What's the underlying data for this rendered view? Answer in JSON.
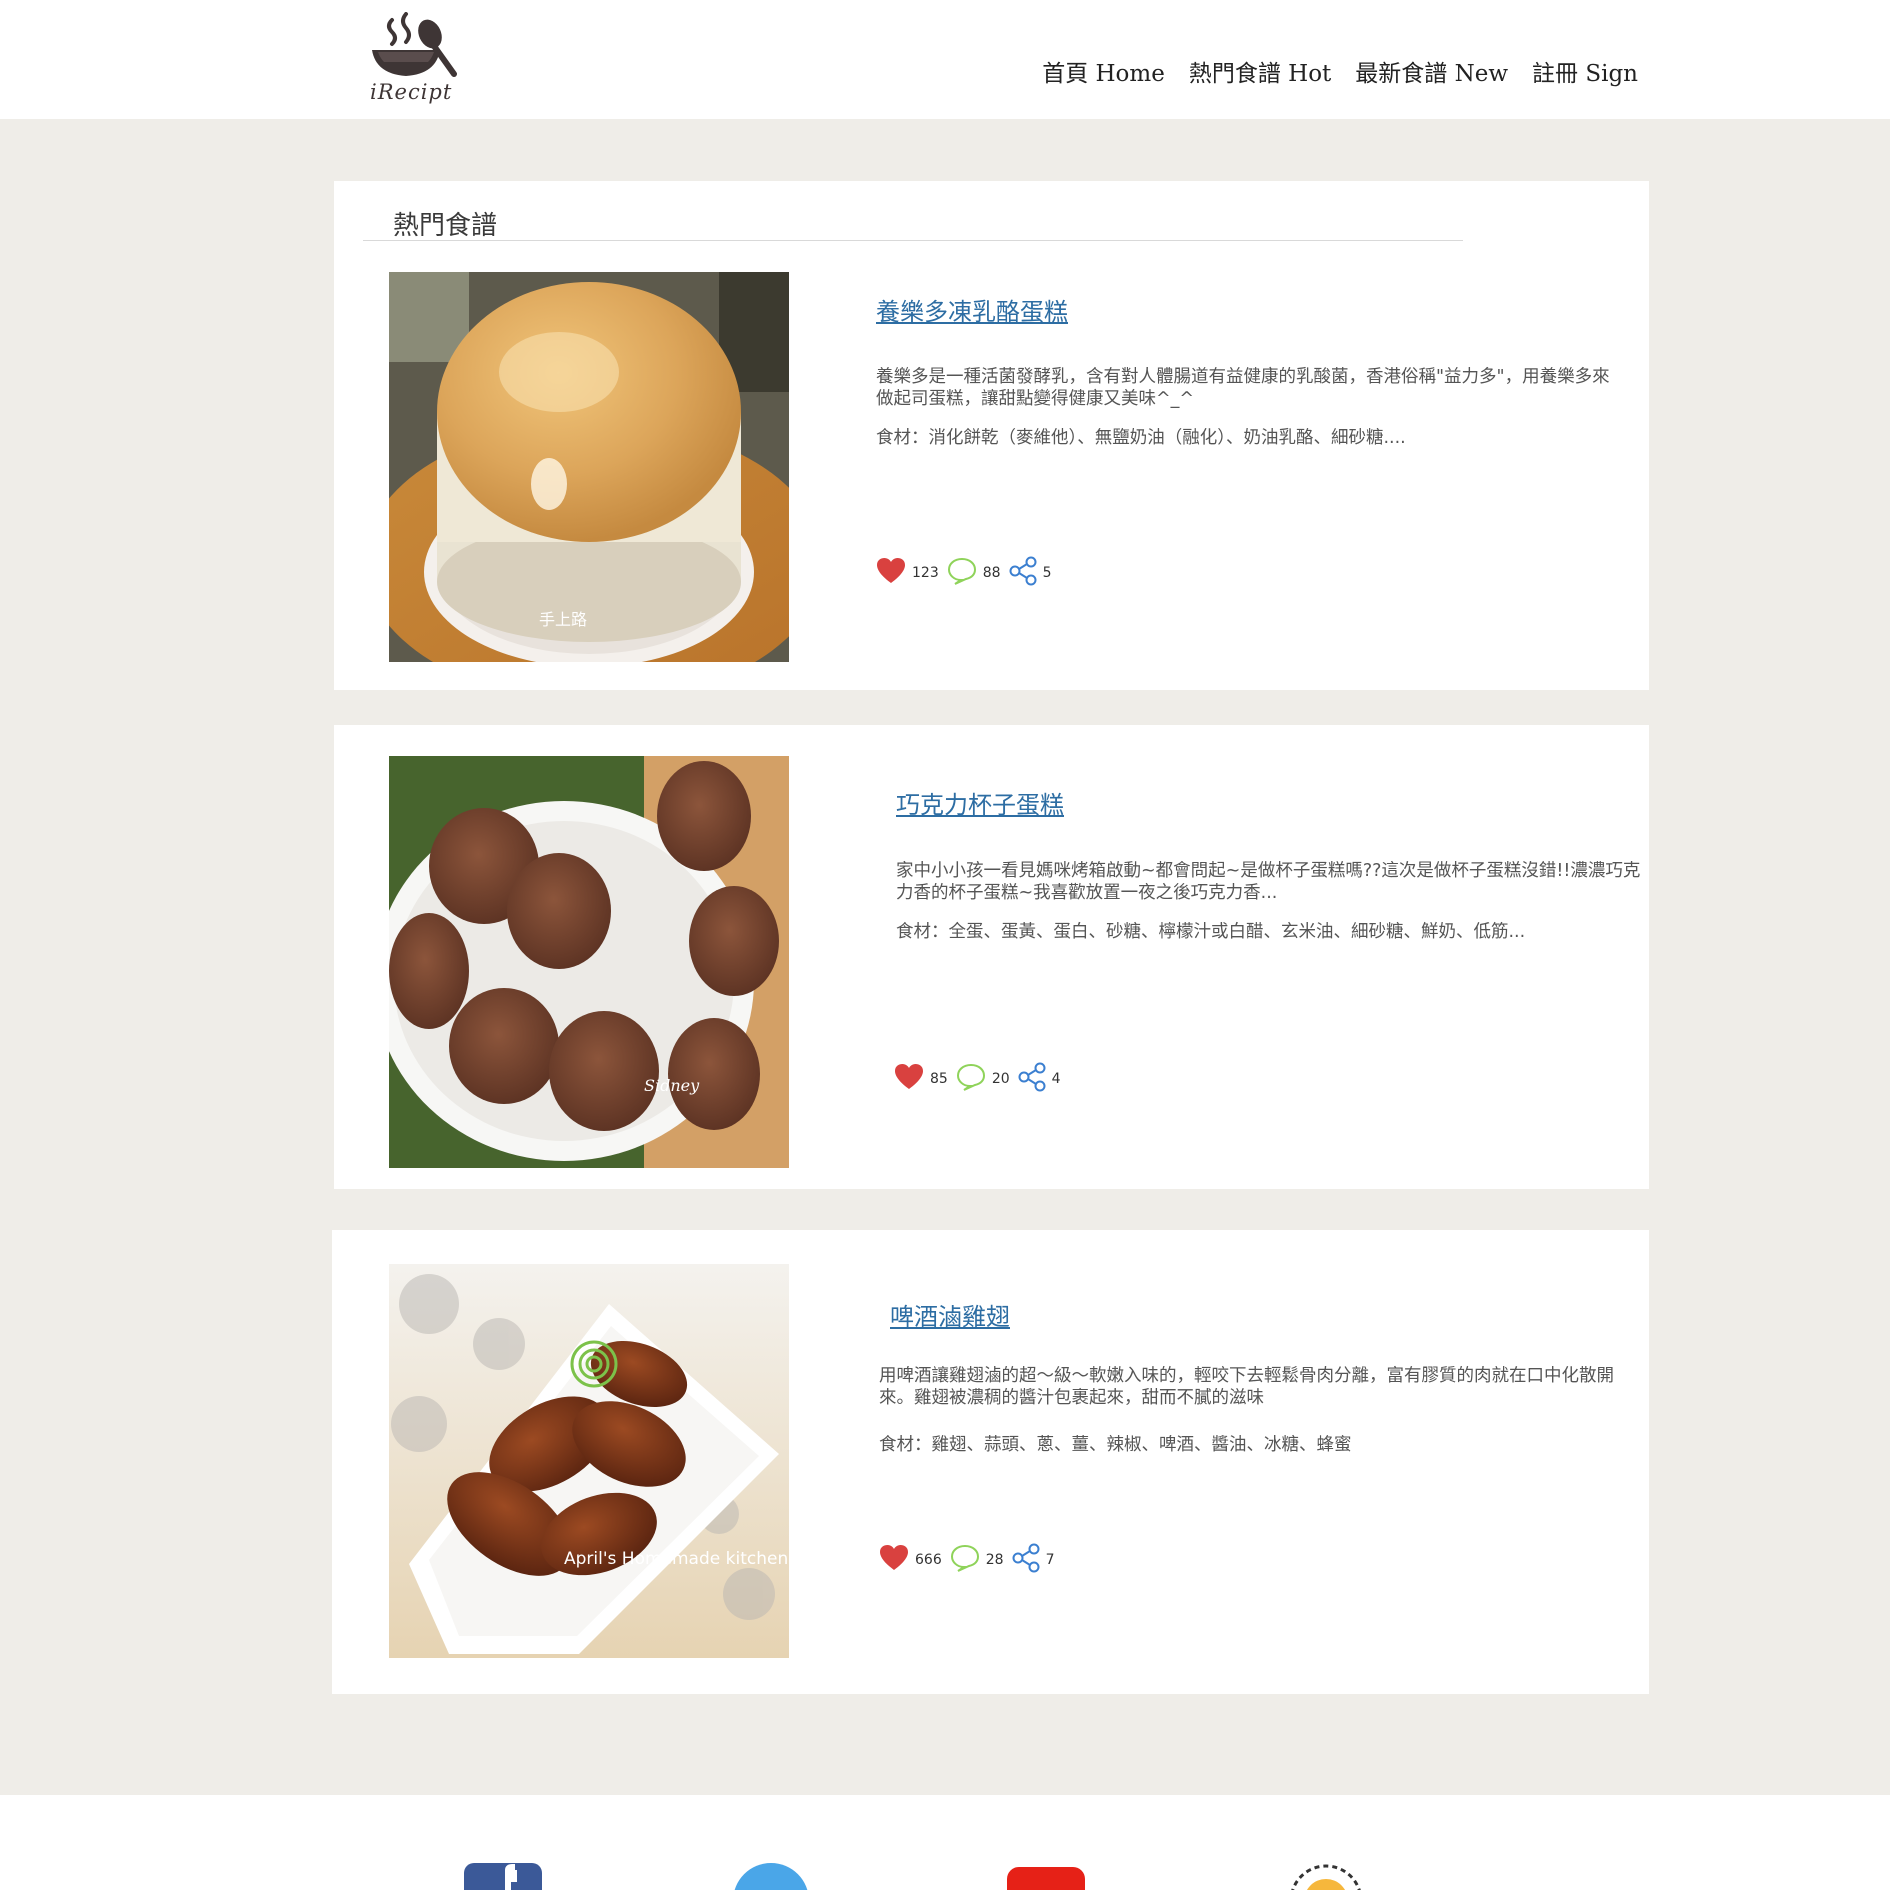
{
  "header": {
    "logo_text": "iRecipt",
    "nav": [
      {
        "label": "首頁 Home"
      },
      {
        "label": "熱門食譜 Hot"
      },
      {
        "label": "最新食譜 New"
      },
      {
        "label": "註冊 Sign"
      }
    ]
  },
  "section": {
    "title": "熱門食譜"
  },
  "recipes": [
    {
      "title": "養樂多凍乳酪蛋糕",
      "desc": "養樂多是一種活菌發酵乳，含有對人體腸道有益健康的乳酸菌，香港俗稱\"益力多\"，用養樂多來做起司蛋糕，讓甜點變得健康又美味^_^",
      "ingredients": "食材：消化餅乾（麥維他）、無鹽奶油（融化）、奶油乳酪、細砂糖....",
      "likes": "123",
      "comments": "88",
      "shares": "5",
      "watermark": "手上路"
    },
    {
      "title": "巧克力杯子蛋糕",
      "desc": "家中小小孩一看見媽咪烤箱啟動~都會問起~是做杯子蛋糕嗎??這次是做杯子蛋糕沒錯!!濃濃巧克力香的杯子蛋糕~我喜歡放置一夜之後巧克力香...",
      "ingredients": "食材：全蛋、蛋黃、蛋白、砂糖、檸檬汁或白醋、玄米油、細砂糖、鮮奶、低筋...",
      "likes": "85",
      "comments": "20",
      "shares": "4",
      "watermark": "Sidney"
    },
    {
      "title": "啤酒滷雞翅",
      "desc": "用啤酒讓雞翅滷的超～級～軟嫩入味的，輕咬下去輕鬆骨肉分離，富有膠質的肉就在口中化散開來。雞翅被濃稠的醬汁包裹起來，甜而不膩的滋味",
      "ingredients": "食材：雞翅、蒜頭、蔥、薑、辣椒、啤酒、醬油、冰糖、蜂蜜",
      "likes": "666",
      "comments": "28",
      "shares": "7",
      "watermark": "April's Homemade kitchen"
    }
  ],
  "colors": {
    "background": "#efede8",
    "card": "#ffffff",
    "link": "#2d6da3",
    "heart": "#d9413f",
    "comment": "#8fd35a",
    "share": "#3b7fd0"
  },
  "icons": [
    "logo-bowl-icon",
    "heart-icon",
    "comment-icon",
    "share-icon",
    "facebook-icon",
    "twitter-icon",
    "youtube-icon",
    "instagram-icon"
  ]
}
